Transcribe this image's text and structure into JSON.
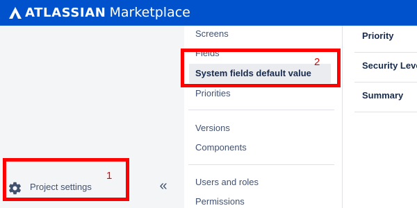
{
  "header": {
    "brand_bold": "ATLASSIAN",
    "brand_product": "Marketplace"
  },
  "sidebar": {
    "project_settings_label": "Project settings",
    "collapse_glyph": "«"
  },
  "nav": {
    "items": [
      "Screens",
      "Fields",
      "System fields default value",
      "Priorities",
      "Versions",
      "Components",
      "Users and roles",
      "Permissions"
    ]
  },
  "content": {
    "rows": [
      "Priority",
      "Security Level",
      "Summary"
    ]
  },
  "annotations": [
    "1",
    "2"
  ],
  "colors": {
    "topbar": "#0052cc",
    "annotation": "#ff0000",
    "sidebar": "#f4f5f7"
  },
  "icons": {
    "logo": "atlassian-logo-icon",
    "settings": "gear-icon",
    "collapse": "double-chevron-left-icon"
  }
}
